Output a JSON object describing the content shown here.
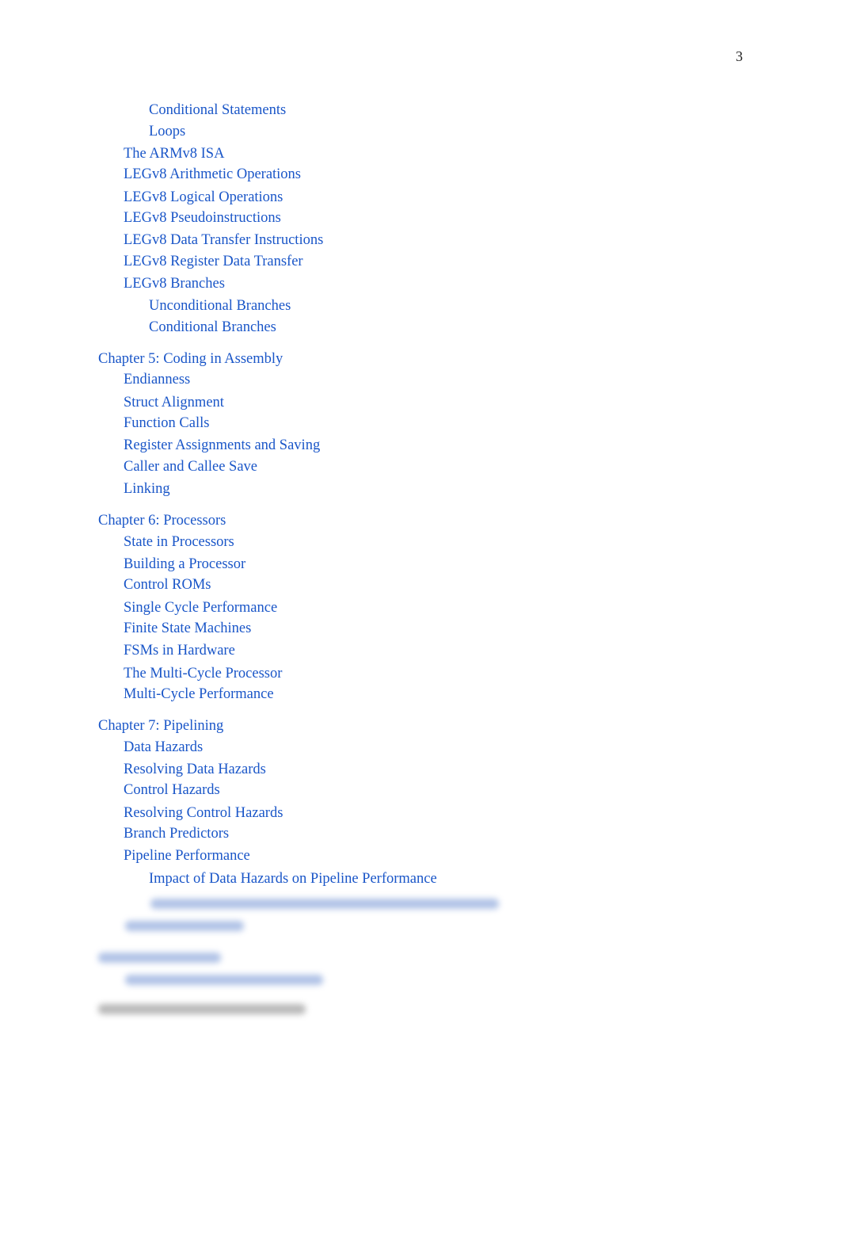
{
  "page_number": "3",
  "link_color": "#1a56c8",
  "toc": [
    {
      "level": 3,
      "text": "Conditional Statements"
    },
    {
      "level": 3,
      "text": "Loops"
    },
    {
      "level": 2,
      "text": "The ARMv8 ISA"
    },
    {
      "level": 2,
      "text": "LEGv8 Arithmetic Operations"
    },
    {
      "level": 2,
      "text": "LEGv8 Logical Operations"
    },
    {
      "level": 2,
      "text": "LEGv8 Pseudoinstructions"
    },
    {
      "level": 2,
      "text": "LEGv8 Data Transfer Instructions"
    },
    {
      "level": 2,
      "text": "LEGv8 Register Data Transfer"
    },
    {
      "level": 2,
      "text": "LEGv8 Branches"
    },
    {
      "level": 3,
      "text": "Unconditional Branches"
    },
    {
      "level": 3,
      "text": "Conditional Branches"
    },
    {
      "level": 1,
      "text": "Chapter 5: Coding in Assembly"
    },
    {
      "level": 2,
      "text": "Endianness"
    },
    {
      "level": 2,
      "text": "Struct Alignment"
    },
    {
      "level": 2,
      "text": "Function Calls"
    },
    {
      "level": 2,
      "text": "Register Assignments and Saving"
    },
    {
      "level": 2,
      "text": "Caller and Callee Save"
    },
    {
      "level": 2,
      "text": "Linking"
    },
    {
      "level": 1,
      "text": "Chapter 6: Processors"
    },
    {
      "level": 2,
      "text": "State in Processors"
    },
    {
      "level": 2,
      "text": "Building a Processor"
    },
    {
      "level": 2,
      "text": "Control ROMs"
    },
    {
      "level": 2,
      "text": "Single Cycle Performance"
    },
    {
      "level": 2,
      "text": "Finite State Machines"
    },
    {
      "level": 2,
      "text": "FSMs in Hardware"
    },
    {
      "level": 2,
      "text": "The Multi-Cycle Processor"
    },
    {
      "level": 2,
      "text": "Multi-Cycle Performance"
    },
    {
      "level": 1,
      "text": "Chapter 7: Pipelining"
    },
    {
      "level": 2,
      "text": "Data Hazards"
    },
    {
      "level": 2,
      "text": "Resolving Data Hazards"
    },
    {
      "level": 2,
      "text": "Control Hazards"
    },
    {
      "level": 2,
      "text": "Resolving Control Hazards"
    },
    {
      "level": 2,
      "text": "Branch Predictors"
    },
    {
      "level": 2,
      "text": "Pipeline Performance"
    },
    {
      "level": 3,
      "text": "Impact of Data Hazards on Pipeline Performance"
    }
  ]
}
